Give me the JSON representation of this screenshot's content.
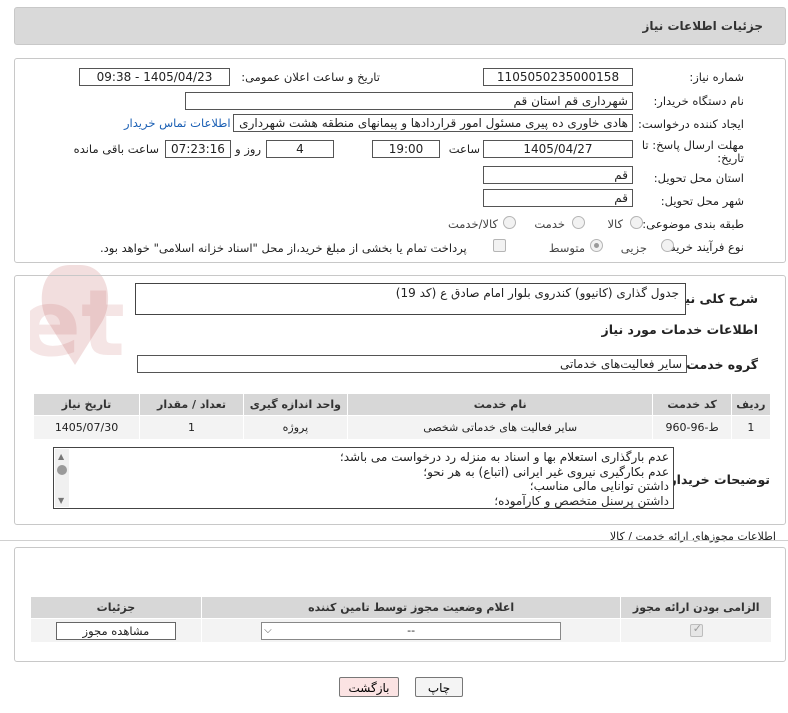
{
  "header": {
    "title": "جزئیات اطلاعات نیاز"
  },
  "form": {
    "need_number_label": "شماره نیاز:",
    "need_number": "1105050235000158",
    "announce_label": "تاریخ و ساعت اعلان عمومی:",
    "announce_value": "1405/04/23 - 09:38",
    "buyer_org_label": "نام دستگاه خریدار:",
    "buyer_org": "شهرداری قم استان قم",
    "requester_label": "ایجاد کننده درخواست:",
    "requester": "هادی خاوری ده پیری مسئول امور قراردادها و پیمانهای منطقه هشت شهرداری",
    "contact_link": "اطلاعات تماس خریدار",
    "deadline_label_1": "مهلت ارسال پاسخ: تا",
    "deadline_label_2": "تاریخ:",
    "deadline_date": "1405/04/27",
    "hour_label": "ساعت",
    "deadline_hour": "19:00",
    "days_value": "4",
    "days_label": "روز و",
    "remaining_time": "07:23:16",
    "remaining_label": "ساعت باقی مانده",
    "province_label": "استان محل تحویل:",
    "province": "قم",
    "city_label": "شهر محل تحویل:",
    "city": "قم",
    "category_label": "طبقه بندی موضوعی:",
    "category_options": [
      "کالا",
      "خدمت",
      "کالا/خدمت"
    ],
    "process_label": "نوع فرآیند خرید :",
    "process_options": [
      "جزیی",
      "متوسط"
    ],
    "payment_note": "پرداخت تمام یا بخشی از مبلغ خرید،از محل \"اسناد خزانه اسلامی\" خواهد بود."
  },
  "description": {
    "label": "شرح کلی نیاز:",
    "value": "جدول گذاری (کانیوو) کندروی بلوار امام صادق ع (کد 19)"
  },
  "services": {
    "section_title": "اطلاعات خدمات مورد نیاز",
    "group_label": "گروه خدمت:",
    "group_value": "سایر فعالیت‌های خدماتی",
    "columns": [
      "ردیف",
      "کد خدمت",
      "نام خدمت",
      "واحد اندازه گیری",
      "تعداد / مقدار",
      "تاریخ نیاز"
    ],
    "rows": [
      [
        "1",
        "ط-96-960",
        "سایر فعالیت های خدماتی شخصی",
        "پروژه",
        "1",
        "1405/07/30"
      ]
    ]
  },
  "buyer_notes": {
    "label": "توضیحات خریدار:",
    "lines": [
      "عدم بارگذاری استعلام بها و اسناد به منزله رد درخواست می باشد؛",
      "عدم بکارگیری نیروی غیر ایرانی (اتباع) به هر نحو؛",
      "داشتن توانایی مالی مناسب؛",
      "داشتن پرسنل متخصص و کارآموده؛"
    ]
  },
  "permits": {
    "section_title": "اطلاعات مجوزهای ارائه خدمت / کالا",
    "columns": [
      "الزامی بودن ارائه مجوز",
      "اعلام وضعیت مجوز توسط تامین کننده",
      "جزئیات"
    ],
    "select_value": "--",
    "view_button": "مشاهده مجوز"
  },
  "actions": {
    "print": "چاپ",
    "back": "بازگشت"
  },
  "watermark": "AriaTender.net"
}
